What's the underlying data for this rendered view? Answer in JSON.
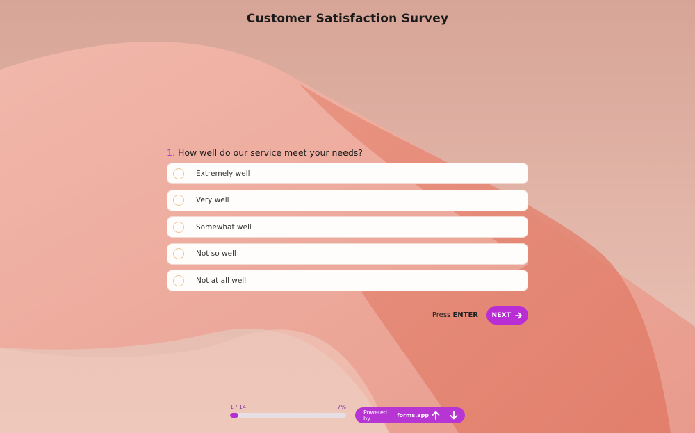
{
  "page": {
    "title": "Customer Satisfaction Survey"
  },
  "question": {
    "number": "1.",
    "text": "How well do our service meet your needs?",
    "options": [
      {
        "label": "Extremely well"
      },
      {
        "label": "Very well"
      },
      {
        "label": "Somewhat well"
      },
      {
        "label": "Not so well"
      },
      {
        "label": "Not at all well"
      }
    ]
  },
  "actions": {
    "press_text": "Press",
    "press_key": "ENTER",
    "next_label": "NEXT"
  },
  "progress": {
    "step_label": "1 / 14",
    "percent_label": "7%",
    "value": 0.07
  },
  "footer": {
    "powered_by": "Powered by",
    "brand": "forms.app"
  },
  "colors": {
    "accent": "#b92ed4",
    "background": "#dcaea0"
  },
  "icons": {
    "next": "arrow-right-icon",
    "up": "arrow-up-icon",
    "down": "arrow-down-icon"
  }
}
